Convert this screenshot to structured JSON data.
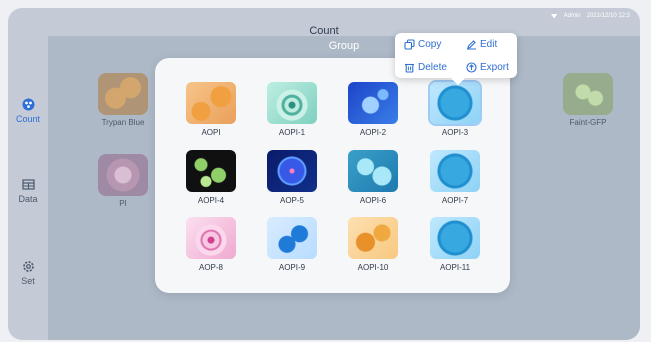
{
  "status": {
    "user": "Admin",
    "datetime": "2021/12/10 12:3"
  },
  "header": {
    "title": "Count"
  },
  "sidebar": {
    "items": [
      {
        "label": "Count",
        "icon": "count-icon",
        "active": true
      },
      {
        "label": "Data",
        "icon": "table-icon",
        "active": false
      },
      {
        "label": "Set",
        "icon": "gear-icon",
        "active": false
      }
    ]
  },
  "background_items": [
    {
      "label": "Trypan Blue",
      "icon": "trypan-blue-image"
    },
    {
      "label": "PI",
      "icon": "pi-image"
    },
    {
      "label": "Faint-GFP",
      "icon": "faint-gfp-image"
    }
  ],
  "group": {
    "title": "Group",
    "items": [
      {
        "label": "AOPI",
        "icon": "aopi-image"
      },
      {
        "label": "AOPI-1",
        "icon": "aopi-1-image"
      },
      {
        "label": "AOPI-2",
        "icon": "aopi-2-image"
      },
      {
        "label": "AOPI-3",
        "icon": "aopi-3-image",
        "selected": true
      },
      {
        "label": "AOPI-4",
        "icon": "aopi-4-image"
      },
      {
        "label": "AOP-5",
        "icon": "aop-5-image"
      },
      {
        "label": "AOPI-6",
        "icon": "aopi-6-image"
      },
      {
        "label": "AOPI-7",
        "icon": "aopi-7-image"
      },
      {
        "label": "AOP-8",
        "icon": "aop-8-image"
      },
      {
        "label": "AOPI-9",
        "icon": "aopi-9-image"
      },
      {
        "label": "AOPI-10",
        "icon": "aopi-10-image"
      },
      {
        "label": "AOPI-11",
        "icon": "aopi-11-image"
      }
    ]
  },
  "context_menu": {
    "copy": "Copy",
    "edit": "Edit",
    "delete": "Delete",
    "export": "Export"
  },
  "colors": {
    "accent": "#2d6fd6",
    "overlay": "#aeb9c8",
    "modal": "#f6f7f9"
  }
}
